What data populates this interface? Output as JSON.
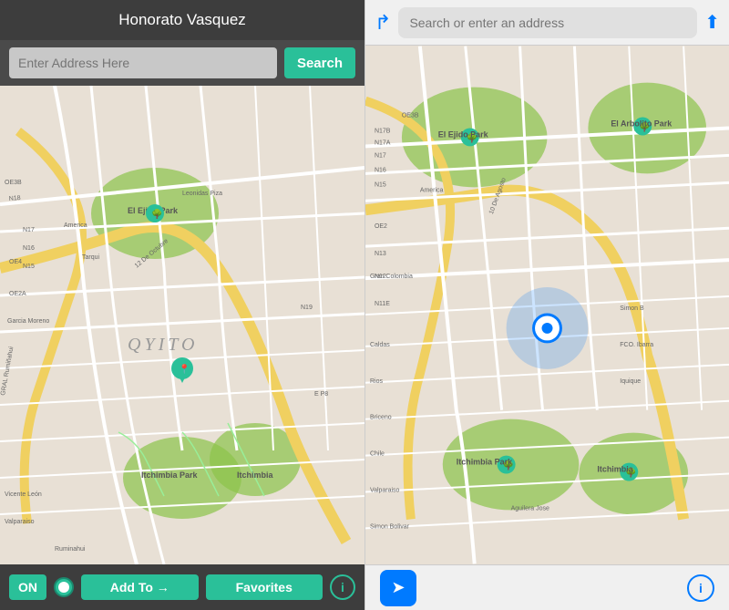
{
  "left": {
    "header": {
      "title": "Honorato Vasquez"
    },
    "search": {
      "placeholder": "Enter Address Here",
      "button_label": "Search"
    },
    "bottom": {
      "toggle_label": "ON",
      "add_to_label": "Add To →",
      "favorites_label": "Favorites",
      "info_label": "i"
    }
  },
  "right": {
    "search": {
      "placeholder": "Search or enter an address"
    },
    "bottom": {
      "location_icon": "➤",
      "info_label": "i"
    }
  },
  "map_left": {
    "labels": [
      "QΥΙΤΟ",
      "El Ejido Park",
      "Itchimbia Park",
      "Itchimbia",
      "N17",
      "N16",
      "N15",
      "N18",
      "OE4",
      "OE2A",
      "OE3B",
      "Tarqui",
      "America",
      "12 De Octubre",
      "N19",
      "E P8",
      "Garcia Moreno",
      "GRAL Rumiñahui",
      "Vicente León",
      "Valparaiso",
      "Ruminahui",
      "Leonidas Piza"
    ]
  },
  "map_right": {
    "labels": [
      "El Ejido Park",
      "El Arbolito Park",
      "Itchimbia Park",
      "Itchimbia",
      "N17B",
      "N17A",
      "N17",
      "N16",
      "N15",
      "OE3B",
      "N13",
      "N12",
      "N11E",
      "America",
      "OE2",
      "10 De Agosto",
      "Gran Colombia",
      "Caldas",
      "Rios",
      "Briceno",
      "Chile",
      "Valparaiso",
      "Simon Bolivar",
      "FCO. Ibarra",
      "Iquique",
      "Aguilera Jose"
    ]
  }
}
